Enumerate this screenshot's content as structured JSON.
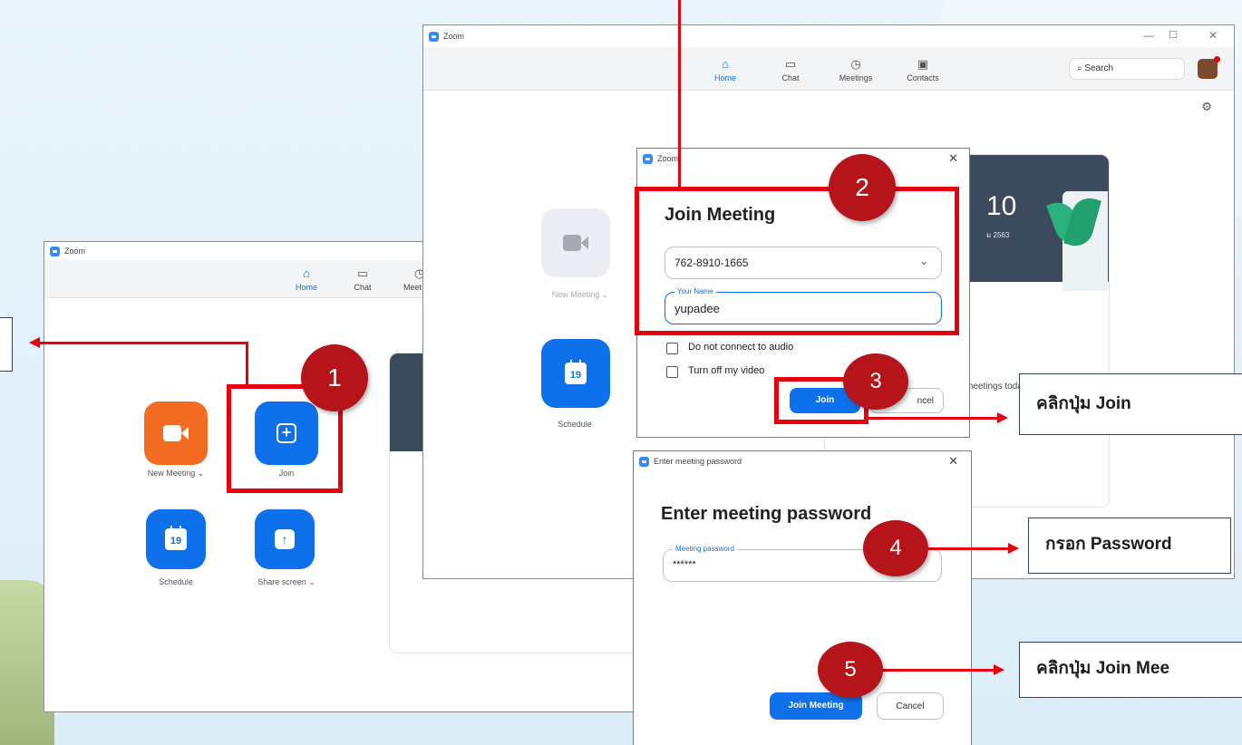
{
  "app_name": "Zoom",
  "nav": {
    "home": "Home",
    "chat": "Chat",
    "meetings": "Meetings",
    "contacts": "Contacts",
    "meetings_partial": "Meet"
  },
  "search": {
    "placeholder": "Search"
  },
  "home_tiles": {
    "new_meeting": "New Meeting",
    "join": "Join",
    "schedule": "Schedule",
    "share_screen": "Share screen",
    "calendar_day": "19"
  },
  "clock_card": {
    "time_partial": "10",
    "date_partial": "ม 2563",
    "no_meetings": "meetings today"
  },
  "join_dialog": {
    "title_bar": "Zoom",
    "heading": "Join Meeting",
    "meeting_id": "762-8910-1665",
    "name_label": "Your Name",
    "name_value": "yupadee",
    "option_audio": "Do not connect to audio",
    "option_video": "Turn off my video",
    "join_button": "Join",
    "cancel_button": "ncel"
  },
  "password_dialog": {
    "title_bar": "Enter meeting password",
    "heading": "Enter meeting password",
    "field_label": "Meeting password",
    "field_value": "******",
    "join_button": "Join Meeting",
    "cancel_button": "Cancel"
  },
  "steps": [
    "1",
    "2",
    "3",
    "4",
    "5"
  ],
  "callouts": {
    "join": "คลิกปุ่ม Join",
    "password": "กรอก Password",
    "join_meeting": "คลิกปุ่ม Join Mee"
  },
  "colors": {
    "zoom_blue": "#0e71eb",
    "zoom_orange": "#f26d21",
    "highlight_red": "#e8000c",
    "badge_red": "#b5141b"
  }
}
